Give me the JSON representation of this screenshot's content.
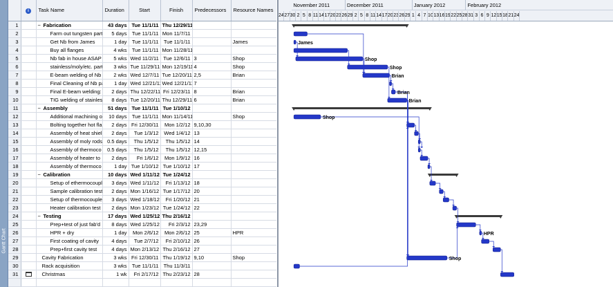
{
  "viewbar_label": "Gantt Chart",
  "columns": {
    "info": "i",
    "name": "Task Name",
    "duration": "Duration",
    "start": "Start",
    "finish": "Finish",
    "predecessors": "Predecessors",
    "resources": "Resource Names"
  },
  "timescale": {
    "months": [
      "November 2011",
      "December 2011",
      "January 2012",
      "February 2012"
    ],
    "days": [
      "24",
      "27",
      "30",
      "2",
      "5",
      "8",
      "11",
      "14",
      "17",
      "20",
      "23",
      "26",
      "29",
      "2",
      "5",
      "8",
      "11",
      "14",
      "17",
      "20",
      "23",
      "26",
      "29",
      "1",
      "4",
      "7",
      "10",
      "13",
      "16",
      "19",
      "22",
      "25",
      "28",
      "31",
      "3",
      "6",
      "9",
      "12",
      "15",
      "18",
      "21",
      "24"
    ]
  },
  "tasks": [
    {
      "id": "1",
      "name": "Fabrication",
      "duration": "43 days",
      "start": "Tue 11/1/11",
      "finish": "Thu 12/29/11",
      "pred": "",
      "res": "",
      "summary": true
    },
    {
      "id": "2",
      "name": "Farm out tungsten part",
      "duration": "5 days",
      "start": "Tue 11/1/11",
      "finish": "Mon 11/7/11",
      "pred": "",
      "res": ""
    },
    {
      "id": "3",
      "name": "Get Nb from James",
      "duration": "1 day",
      "start": "Tue 11/1/11",
      "finish": "Tue 11/1/11",
      "pred": "",
      "res": "James"
    },
    {
      "id": "4",
      "name": "Buy all flanges",
      "duration": "4 wks",
      "start": "Tue 11/1/11",
      "finish": "Mon 11/28/11",
      "pred": "",
      "res": ""
    },
    {
      "id": "5",
      "name": "Nb fab in house ASAP",
      "duration": "5 wks",
      "start": "Wed 11/2/11",
      "finish": "Tue 12/6/11",
      "pred": "3",
      "res": "Shop"
    },
    {
      "id": "6",
      "name": "stainless/moly/etc. part",
      "duration": "3 wks",
      "start": "Tue 11/29/11",
      "finish": "Mon 12/19/11",
      "pred": "4",
      "res": "Shop"
    },
    {
      "id": "7",
      "name": "E-beam welding of Nb",
      "duration": "2 wks",
      "start": "Wed 12/7/11",
      "finish": "Tue 12/20/11",
      "pred": "2,5",
      "res": "Brian"
    },
    {
      "id": "8",
      "name": "Final Cleaning of Nb pa",
      "duration": "1 day",
      "start": "Wed 12/21/11",
      "finish": "Wed 12/21/11",
      "pred": "7",
      "res": ""
    },
    {
      "id": "9",
      "name": "Final E-beam welding:",
      "duration": "2 days",
      "start": "Thu 12/22/11",
      "finish": "Fri 12/23/11",
      "pred": "8",
      "res": "Brian"
    },
    {
      "id": "10",
      "name": "TIG welding of stainles",
      "duration": "8 days",
      "start": "Tue 12/20/11",
      "finish": "Thu 12/29/11",
      "pred": "6",
      "res": "Brian"
    },
    {
      "id": "11",
      "name": "Assembly",
      "duration": "51 days",
      "start": "Tue 11/1/11",
      "finish": "Tue 1/10/12",
      "pred": "",
      "res": "",
      "summary": true
    },
    {
      "id": "12",
      "name": "Additional machining of",
      "duration": "10 days",
      "start": "Tue 11/1/11",
      "finish": "Mon 11/14/11",
      "pred": "",
      "res": "Shop"
    },
    {
      "id": "13",
      "name": "Bolting together hot fla",
      "duration": "2 days",
      "start": "Fri 12/30/11",
      "finish": "Mon 1/2/12",
      "pred": "9,10,30",
      "res": ""
    },
    {
      "id": "14",
      "name": "Assembly of heat shiel",
      "duration": "2 days",
      "start": "Tue 1/3/12",
      "finish": "Wed 1/4/12",
      "pred": "13",
      "res": ""
    },
    {
      "id": "15",
      "name": "Assembly of moly rods",
      "duration": "0.5 days",
      "start": "Thu 1/5/12",
      "finish": "Thu 1/5/12",
      "pred": "14",
      "res": ""
    },
    {
      "id": "16",
      "name": "Assembly of thermoco",
      "duration": "0.5 days",
      "start": "Thu 1/5/12",
      "finish": "Thu 1/5/12",
      "pred": "12,15",
      "res": ""
    },
    {
      "id": "17",
      "name": "Assembly of heater to",
      "duration": "2 days",
      "start": "Fri 1/6/12",
      "finish": "Mon 1/9/12",
      "pred": "16",
      "res": ""
    },
    {
      "id": "18",
      "name": "Assembly of thermoco",
      "duration": "1 day",
      "start": "Tue 1/10/12",
      "finish": "Tue 1/10/12",
      "pred": "17",
      "res": ""
    },
    {
      "id": "19",
      "name": "Calibration",
      "duration": "10 days",
      "start": "Wed 1/11/12",
      "finish": "Tue 1/24/12",
      "pred": "",
      "res": "",
      "summary": true
    },
    {
      "id": "20",
      "name": "Setup of ethermocoupl",
      "duration": "3 days",
      "start": "Wed 1/11/12",
      "finish": "Fri 1/13/12",
      "pred": "18",
      "res": ""
    },
    {
      "id": "21",
      "name": "Sample calibration test",
      "duration": "2 days",
      "start": "Mon 1/16/12",
      "finish": "Tue 1/17/12",
      "pred": "20",
      "res": ""
    },
    {
      "id": "22",
      "name": "Setup of thermocouple",
      "duration": "3 days",
      "start": "Wed 1/18/12",
      "finish": "Fri 1/20/12",
      "pred": "21",
      "res": ""
    },
    {
      "id": "23",
      "name": "Heater calibration test",
      "duration": "2 days",
      "start": "Mon 1/23/12",
      "finish": "Tue 1/24/12",
      "pred": "22",
      "res": ""
    },
    {
      "id": "24",
      "name": "Testing",
      "duration": "17 days",
      "start": "Wed 1/25/12",
      "finish": "Thu 2/16/12",
      "pred": "",
      "res": "",
      "summary": true
    },
    {
      "id": "25",
      "name": "Prep+test of just fab'd",
      "duration": "8 days",
      "start": "Wed 1/25/12",
      "finish": "Fri 2/3/12",
      "pred": "23,29",
      "res": ""
    },
    {
      "id": "26",
      "name": "HPR + dry",
      "duration": "1 day",
      "start": "Mon 2/6/12",
      "finish": "Mon 2/6/12",
      "pred": "25",
      "res": "HPR"
    },
    {
      "id": "27",
      "name": "First coating of cavity",
      "duration": "4 days",
      "start": "Tue 2/7/12",
      "finish": "Fri 2/10/12",
      "pred": "26",
      "res": ""
    },
    {
      "id": "28",
      "name": "Prep+first cavity test",
      "duration": "4 days",
      "start": "Mon 2/13/12",
      "finish": "Thu 2/16/12",
      "pred": "27",
      "res": ""
    },
    {
      "id": "29",
      "name": "Cavity Fabrication",
      "duration": "3 wks",
      "start": "Fri 12/30/11",
      "finish": "Thu 1/19/12",
      "pred": "9,10",
      "res": "Shop",
      "top": true
    },
    {
      "id": "30",
      "name": "Rack acquisition",
      "duration": "3 wks",
      "start": "Tue 11/1/11",
      "finish": "Thu 11/3/11",
      "pred": "",
      "res": "",
      "top": true
    },
    {
      "id": "31",
      "name": "Christmas",
      "duration": "1 wk",
      "start": "Fri 2/17/12",
      "finish": "Thu 2/23/12",
      "pred": "28",
      "res": "",
      "top": true,
      "icon": "calendar-icon"
    }
  ],
  "empty_rows": 2,
  "colors": {
    "task_bar": "#2438c8",
    "summary_bar": "#3a3a3a",
    "link": "#2438c8",
    "grid_header": "#eef1f6"
  }
}
